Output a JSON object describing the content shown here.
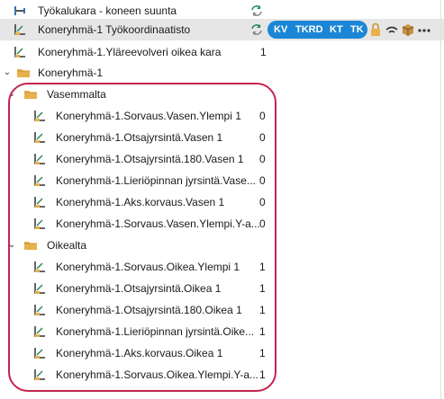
{
  "rows": [
    {
      "label": "Työkalukara - koneen suunta",
      "value": ""
    },
    {
      "label": "Koneryhmä-1 Työkoordinaatisto",
      "value": ""
    },
    {
      "label": "Koneryhmä-1.Yläreevolveri oikea kara",
      "value": "1"
    },
    {
      "label": "Koneryhmä-1",
      "value": ""
    },
    {
      "label": "Vasemmalta",
      "value": ""
    },
    {
      "label": "Koneryhmä-1.Sorvaus.Vasen.Ylempi 1",
      "value": "0"
    },
    {
      "label": "Koneryhmä-1.Otsajyrsintä.Vasen 1",
      "value": "0"
    },
    {
      "label": "Koneryhmä-1.Otsajyrsintä.180.Vasen 1",
      "value": "0"
    },
    {
      "label": "Koneryhmä-1.Lieriöpinnan jyrsintä.Vase...",
      "value": "0"
    },
    {
      "label": "Koneryhmä-1.Aks.korvaus.Vasen 1",
      "value": "0"
    },
    {
      "label": "Koneryhmä-1.Sorvaus.Vasen.Ylempi.Y-a...",
      "value": "0"
    },
    {
      "label": "Oikealta",
      "value": ""
    },
    {
      "label": "Koneryhmä-1.Sorvaus.Oikea.Ylempi 1",
      "value": "1"
    },
    {
      "label": "Koneryhmä-1.Otsajyrsintä.Oikea 1",
      "value": "1"
    },
    {
      "label": "Koneryhmä-1.Otsajyrsintä.180.Oikea 1",
      "value": "1"
    },
    {
      "label": "Koneryhmä-1.Lieriöpinnan jyrsintä.Oike...",
      "value": "1"
    },
    {
      "label": "Koneryhmä-1.Aks.korvaus.Oikea 1",
      "value": "1"
    },
    {
      "label": "Koneryhmä-1.Sorvaus.Oikea.Ylempi.Y-a...",
      "value": "1"
    }
  ],
  "badges": {
    "kv": "KV",
    "tkrd": "TKRD",
    "kt": "KT",
    "tk": "TK"
  },
  "icons": {
    "sync": "sync-icon",
    "lock": "lock-icon",
    "wifi": "wireless-icon",
    "box": "box-icon",
    "more": "more-icon",
    "folder": "folder-icon",
    "plane": "coordinate-plane-icon"
  },
  "colors": {
    "selection": "#e6e6e6",
    "badge": "#1c86d6",
    "annotation": "#c3244f",
    "folder": "#e8b14a"
  }
}
